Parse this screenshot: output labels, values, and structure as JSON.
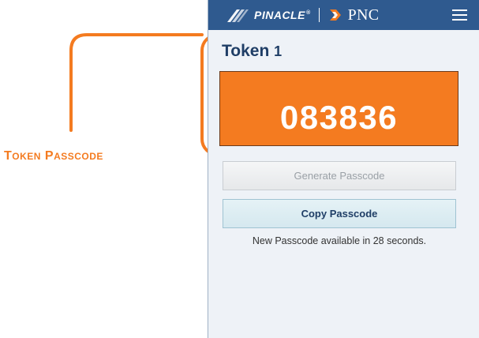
{
  "header": {
    "brand_pinacle": "PINACLE",
    "brand_trademark": "®",
    "brand_pnc": "PNC",
    "menu_icon": "hamburger-menu-icon"
  },
  "token": {
    "title": "Token",
    "number": "1",
    "passcode": "083836"
  },
  "actions": {
    "generate_label": "Generate Passcode",
    "copy_label": "Copy Passcode"
  },
  "status": {
    "countdown_text": "New Passcode available in 28 seconds."
  },
  "annotation": {
    "label_first_initial": "T",
    "label_first_rest": "OKEN",
    "label_second_initial": "P",
    "label_second_rest": "ASSCODE"
  },
  "colors": {
    "header_bg": "#2f5a8f",
    "passcode_bg": "#f47b20",
    "callout": "#f47b20",
    "title": "#1f3e66"
  }
}
